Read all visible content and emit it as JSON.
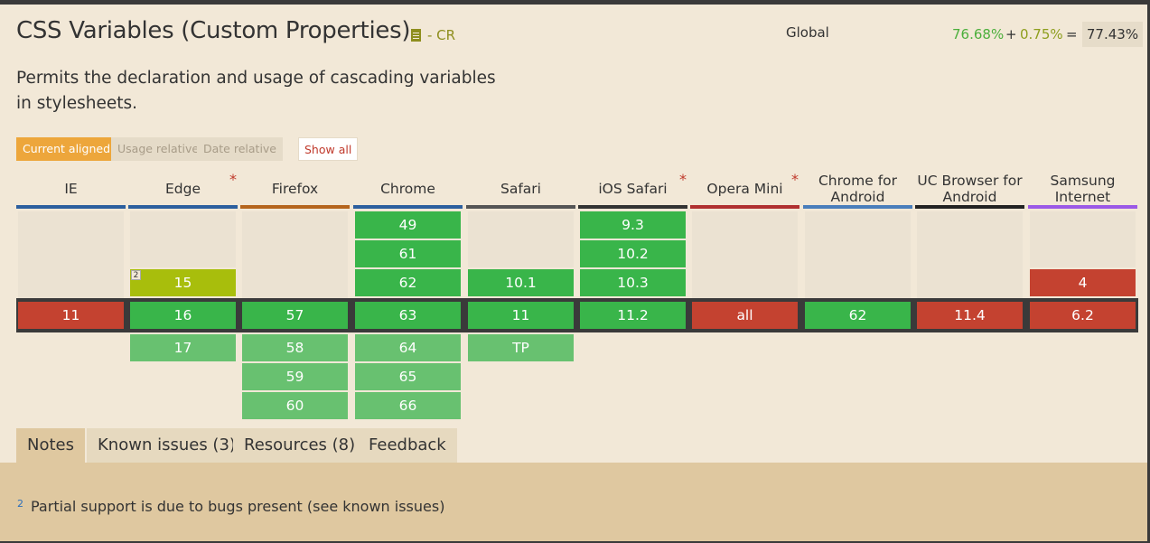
{
  "feature": {
    "title": "CSS Variables (Custom Properties)",
    "status": "- CR",
    "description": "Permits the declaration and usage of cascading variables in stylesheets.",
    "spec_icon": "document-icon"
  },
  "usage": {
    "region": "Global",
    "full": "76.68%",
    "plus": "+",
    "partial": "0.75%",
    "equals": "=",
    "total": "77.43%"
  },
  "modes": {
    "current": "Current aligned",
    "usage": "Usage relative",
    "date": "Date relative",
    "show_all": "Show all"
  },
  "colors": {
    "supported": "#39b54a",
    "not_supported": "#c44230",
    "partial": "#a8be0c",
    "future": "#68c170",
    "accent": "#eda63b"
  },
  "browsers": [
    {
      "name": "IE",
      "asterisk": ""
    },
    {
      "name": "Edge",
      "asterisk": "*"
    },
    {
      "name": "Firefox",
      "asterisk": ""
    },
    {
      "name": "Chrome",
      "asterisk": ""
    },
    {
      "name": "Safari",
      "asterisk": ""
    },
    {
      "name": "iOS Safari",
      "asterisk": "*"
    },
    {
      "name": "Opera Mini",
      "asterisk": "*"
    },
    {
      "name": "Chrome for Android",
      "asterisk": ""
    },
    {
      "name": "UC Browser for Android",
      "asterisk": ""
    },
    {
      "name": "Samsung Internet",
      "asterisk": ""
    }
  ],
  "past": [
    [
      "",
      "",
      ""
    ],
    [
      "",
      "",
      "15"
    ],
    [
      "",
      "",
      ""
    ],
    [
      "49",
      "61",
      "62"
    ],
    [
      "",
      "",
      "10.1"
    ],
    [
      "9.3",
      "10.2",
      "10.3"
    ],
    [
      "",
      "",
      ""
    ],
    [
      "",
      "",
      ""
    ],
    [
      "",
      "",
      ""
    ],
    [
      "",
      "",
      "4"
    ]
  ],
  "current": [
    "11",
    "16",
    "57",
    "63",
    "11",
    "11.2",
    "all",
    "62",
    "11.4",
    "6.2"
  ],
  "future": [
    [],
    [
      "17"
    ],
    [
      "58",
      "59",
      "60"
    ],
    [
      "64",
      "65",
      "66"
    ],
    [
      "TP"
    ],
    [],
    [],
    [],
    [],
    []
  ],
  "notes": {
    "partial_note_number": "2",
    "tabs": {
      "notes": "Notes",
      "known_issues": "Known issues (3)",
      "resources": "Resources (8)",
      "feedback": "Feedback"
    },
    "note_number": "2",
    "note_text": "Partial support is due to bugs present (see known issues)"
  }
}
